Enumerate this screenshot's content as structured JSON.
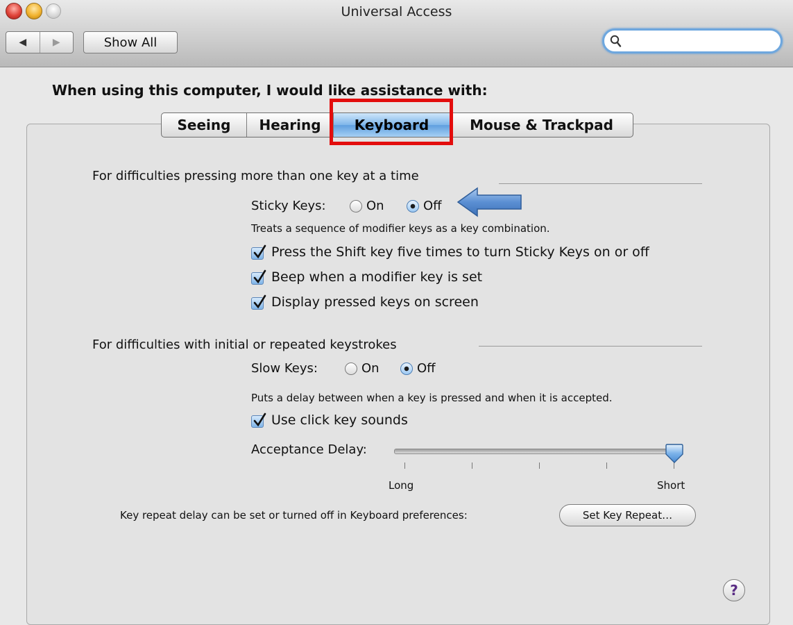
{
  "window": {
    "title": "Universal Access"
  },
  "toolbar": {
    "back_icon": "◀",
    "forward_icon": "▶",
    "show_all_label": "Show All",
    "search_value": "",
    "search_placeholder": ""
  },
  "heading": "When using this computer, I would like assistance with:",
  "tabs": [
    {
      "label": "Seeing",
      "selected": false
    },
    {
      "label": "Hearing",
      "selected": false
    },
    {
      "label": "Keyboard",
      "selected": true
    },
    {
      "label": "Mouse & Trackpad",
      "selected": false
    }
  ],
  "sticky": {
    "section_title": "For difficulties pressing more than one key at a time",
    "label": "Sticky Keys:",
    "on_label": "On",
    "off_label": "Off",
    "selected": "Off",
    "description": "Treats a sequence of modifier keys as a key combination.",
    "options": [
      {
        "label": "Press the Shift key five times to turn Sticky Keys on or off",
        "checked": true
      },
      {
        "label": "Beep when a modifier key is set",
        "checked": true
      },
      {
        "label": "Display pressed keys on screen",
        "checked": true
      }
    ]
  },
  "slow": {
    "section_title": "For difficulties with initial or repeated keystrokes",
    "label": "Slow Keys:",
    "on_label": "On",
    "off_label": "Off",
    "selected": "Off",
    "description": "Puts a delay between when a key is pressed and when it is accepted.",
    "click_sounds_label": "Use click key sounds",
    "click_sounds_checked": true,
    "delay_label": "Acceptance Delay:",
    "delay_min_label": "Long",
    "delay_max_label": "Short",
    "delay_value": 1.0
  },
  "key_repeat": {
    "text": "Key repeat delay can be set or turned off in Keyboard preferences:",
    "button_label": "Set Key Repeat…"
  },
  "help_label": "?",
  "colors": {
    "highlight_box": "#e30d0d",
    "annotation_arrow": "#5b8fd3",
    "selected_tab": "#6fa9e6"
  }
}
